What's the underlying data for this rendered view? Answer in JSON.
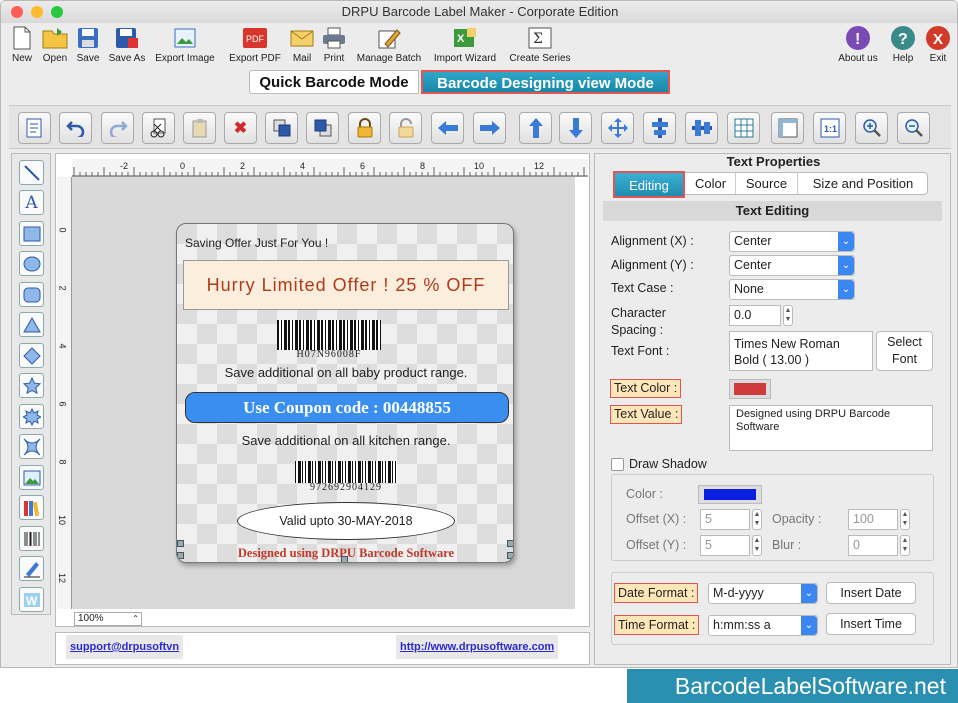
{
  "window": {
    "title": "DRPU Barcode Label Maker - Corporate Edition"
  },
  "toolbar": {
    "new": "New",
    "open": "Open",
    "save": "Save",
    "save_as": "Save As",
    "export_image": "Export Image",
    "export_pdf": "Export PDF",
    "mail": "Mail",
    "print": "Print",
    "manage_batch": "Manage Batch",
    "import_wizard": "Import Wizard",
    "create_series": "Create Series",
    "about": "About us",
    "help": "Help",
    "exit": "Exit"
  },
  "modes": {
    "quick": "Quick Barcode Mode",
    "designing": "Barcode Designing view Mode"
  },
  "canvas": {
    "zoom": "100%",
    "ruler_h": [
      "-2",
      "0",
      "2",
      "4",
      "6",
      "8",
      "10",
      "12",
      "14"
    ],
    "ruler_v": [
      "0",
      "2",
      "4",
      "6",
      "8",
      "10",
      "12"
    ]
  },
  "label": {
    "offer_small": "Saving Offer Just For You !",
    "offer_big": "Hurry Limited Offer ! 25 % OFF",
    "barcode1_text": "H07N96008F",
    "baby_line": "Save additional on all baby product range.",
    "coupon": "Use Coupon code : 00448855",
    "kitchen_line": "Save additional on all kitchen range.",
    "barcode2_text": "972692904129",
    "valid": "Valid upto 30-MAY-2018",
    "designed": "Designed using DRPU Barcode Software"
  },
  "footer": {
    "support": "support@drpusoftvn",
    "website": "http://www.drpusoftware.com"
  },
  "properties": {
    "title": "Text Properties",
    "tabs": [
      "Editing",
      "Color",
      "Source",
      "Size and Position"
    ],
    "section": "Text Editing",
    "align_x_label": "Alignment (X) :",
    "align_x": "Center",
    "align_y_label": "Alignment (Y) :",
    "align_y": "Center",
    "case_label": "Text Case :",
    "case": "None",
    "spacing_label_1": "Character",
    "spacing_label_2": "Spacing :",
    "spacing": "0.0",
    "font_label": "Text Font :",
    "font_value": "Times New Roman Bold ( 13.00 )",
    "select_font": "Select Font",
    "color_label": "Text Color :",
    "text_color": "#d03a3a",
    "value_label": "Text Value :",
    "text_value": "Designed using DRPU Barcode Software",
    "shadow_label": "Draw Shadow",
    "shadow_color_label": "Color :",
    "shadow_color": "#0a1fe0",
    "offset_x_label": "Offset (X) :",
    "offset_x": "5",
    "offset_y_label": "Offset (Y) :",
    "offset_y": "5",
    "opacity_label": "Opacity :",
    "opacity": "100",
    "blur_label": "Blur :",
    "blur": "0",
    "date_label": "Date Format :",
    "date_format": "M-d-yyyy",
    "insert_date": "Insert Date",
    "time_label": "Time Format :",
    "time_format": "h:mm:ss a",
    "insert_time": "Insert Time"
  },
  "brand": "BarcodeLabelSoftware.net"
}
